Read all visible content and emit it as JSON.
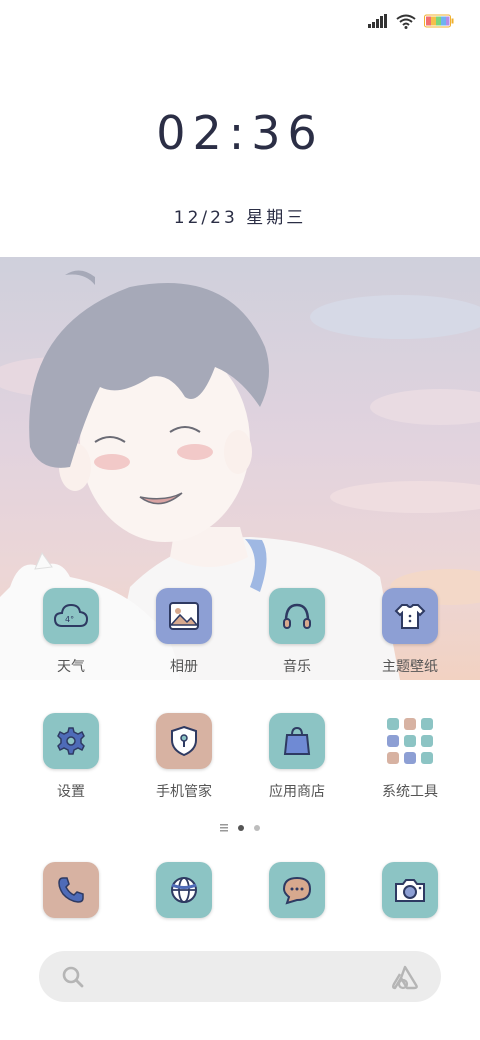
{
  "status_bar": {
    "signal_icon": "signal-bars-icon",
    "wifi_icon": "wifi-icon",
    "battery_icon": "battery-icon"
  },
  "lockscreen": {
    "time": "02:36",
    "date": "12/23 星期三"
  },
  "home": {
    "row1": [
      {
        "label": "天气",
        "icon": "weather-icon",
        "text": "4°"
      },
      {
        "label": "相册",
        "icon": "gallery-icon"
      },
      {
        "label": "音乐",
        "icon": "headphones-icon"
      },
      {
        "label": "主题壁纸",
        "icon": "theme-shirt-icon"
      }
    ],
    "row2": [
      {
        "label": "设置",
        "icon": "gear-icon"
      },
      {
        "label": "手机管家",
        "icon": "shield-icon"
      },
      {
        "label": "应用商店",
        "icon": "shopping-bag-icon"
      },
      {
        "label": "系统工具",
        "icon": "folder-grid-icon"
      }
    ],
    "page_indicator": {
      "pages": 2,
      "current": 1
    },
    "dock": [
      {
        "icon": "phone-icon"
      },
      {
        "icon": "browser-icon"
      },
      {
        "icon": "messages-icon"
      },
      {
        "icon": "camera-icon"
      }
    ],
    "search": {
      "search_icon": "search-icon",
      "assistant_icon": "assistant-icon"
    }
  },
  "colors": {
    "tile_teal": "#8cc4c4",
    "tile_blue": "#8d9fd4",
    "tile_pink": "#d7b2a2",
    "text_dark": "#2b2e45"
  }
}
